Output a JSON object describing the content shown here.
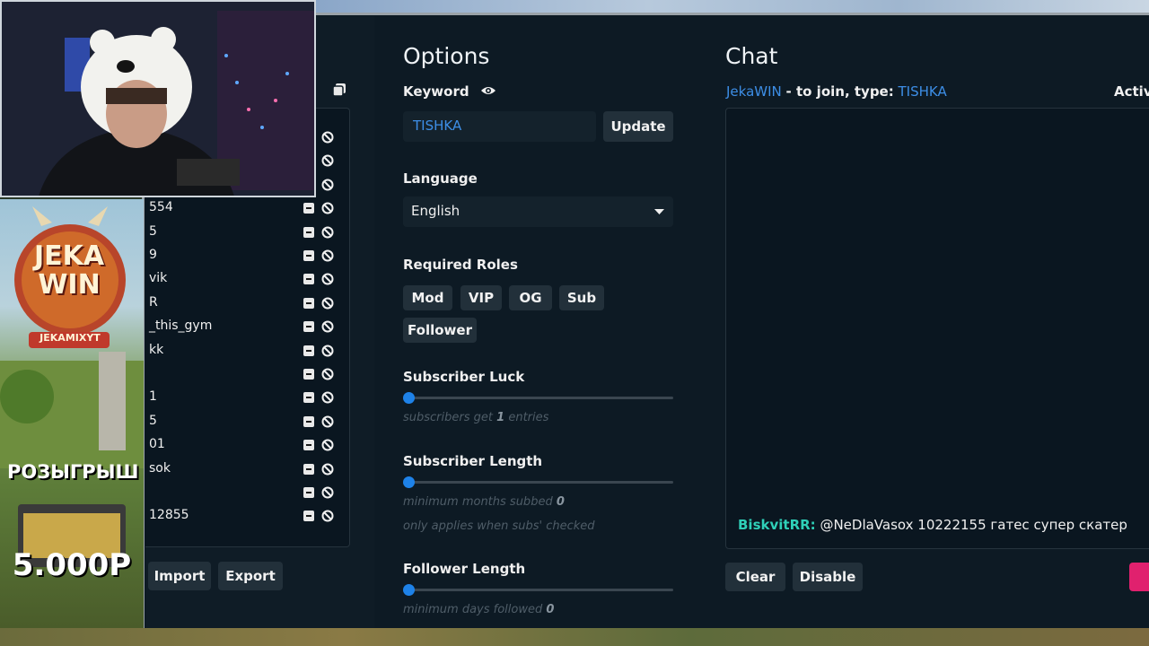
{
  "options": {
    "title": "Options",
    "keyword_label": "Keyword",
    "keyword_value": "TISHKA",
    "update_label": "Update",
    "language_label": "Language",
    "language_value": "English",
    "roles_label": "Required Roles",
    "roles": [
      "Mod",
      "VIP",
      "OG",
      "Sub",
      "Follower"
    ],
    "sub_luck_label": "Subscriber Luck",
    "sub_luck_hint_pre": "subscribers get",
    "sub_luck_hint_val": "1",
    "sub_luck_hint_post": "entries",
    "sub_length_label": "Subscriber Length",
    "sub_length_hint_pre": "minimum months subbed",
    "sub_length_hint_val": "0",
    "sub_length_hint2": "only applies when subs' checked",
    "follower_length_label": "Follower Length",
    "follower_length_hint_pre": "minimum days followed",
    "follower_length_hint_val": "0"
  },
  "chat": {
    "title": "Chat",
    "channel": "JekaWIN",
    "join_text": "- to join, type:",
    "join_keyword": "TISHKA",
    "active_text": "Activ",
    "message_user": "BiskvitRR:",
    "message_text": "@NeDlaVasox 10222155 гатес супер скатер",
    "clear_label": "Clear",
    "disable_label": "Disable"
  },
  "list": {
    "entries": [
      "",
      "",
      "",
      "554",
      "5",
      "9",
      "vik",
      "R",
      "_this_gym",
      "kk",
      "",
      "1",
      "5",
      "01",
      "sok",
      "",
      "12855"
    ],
    "import_label": "Import",
    "export_label": "Export"
  },
  "promo": {
    "logo_text": "JEKA WIN",
    "handle": "JEKAMIXYT",
    "giveaway": "РОЗЫГРЫШ",
    "amount": "5.000Р"
  },
  "colors": {
    "accent": "#1e82e8",
    "keyword_blue": "#3d8ee6",
    "chat_user": "#2fd0b8",
    "pink": "#e0216e"
  }
}
